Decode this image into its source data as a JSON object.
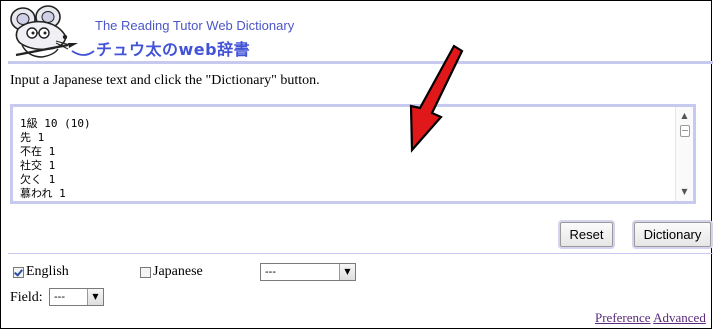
{
  "header": {
    "title_en": "The Reading Tutor Web Dictionary",
    "title_ja": "チュウ太のweb辞書",
    "logo_icon": "mouse-logo-icon"
  },
  "instruction": "Input a Japanese text and click the \"Dictionary\" button.",
  "textarea": {
    "lines": [
      "1級 10 (10)",
      "先 1",
      "不在 1",
      "社交 1",
      "欠く 1",
      "慕われ 1"
    ]
  },
  "buttons": {
    "reset": "Reset",
    "dictionary": "Dictionary"
  },
  "options": {
    "english_label": "English",
    "english_checked": true,
    "japanese_label": "Japanese",
    "japanese_checked": false,
    "lang_select_value": "---",
    "field_label": "Field:",
    "field_select_value": "---"
  },
  "links": {
    "preference": "Preference",
    "advanced": "Advanced"
  },
  "colors": {
    "accent": "#4b56c8",
    "rule": "#c8c9ee",
    "arrow": "#e0181a"
  }
}
